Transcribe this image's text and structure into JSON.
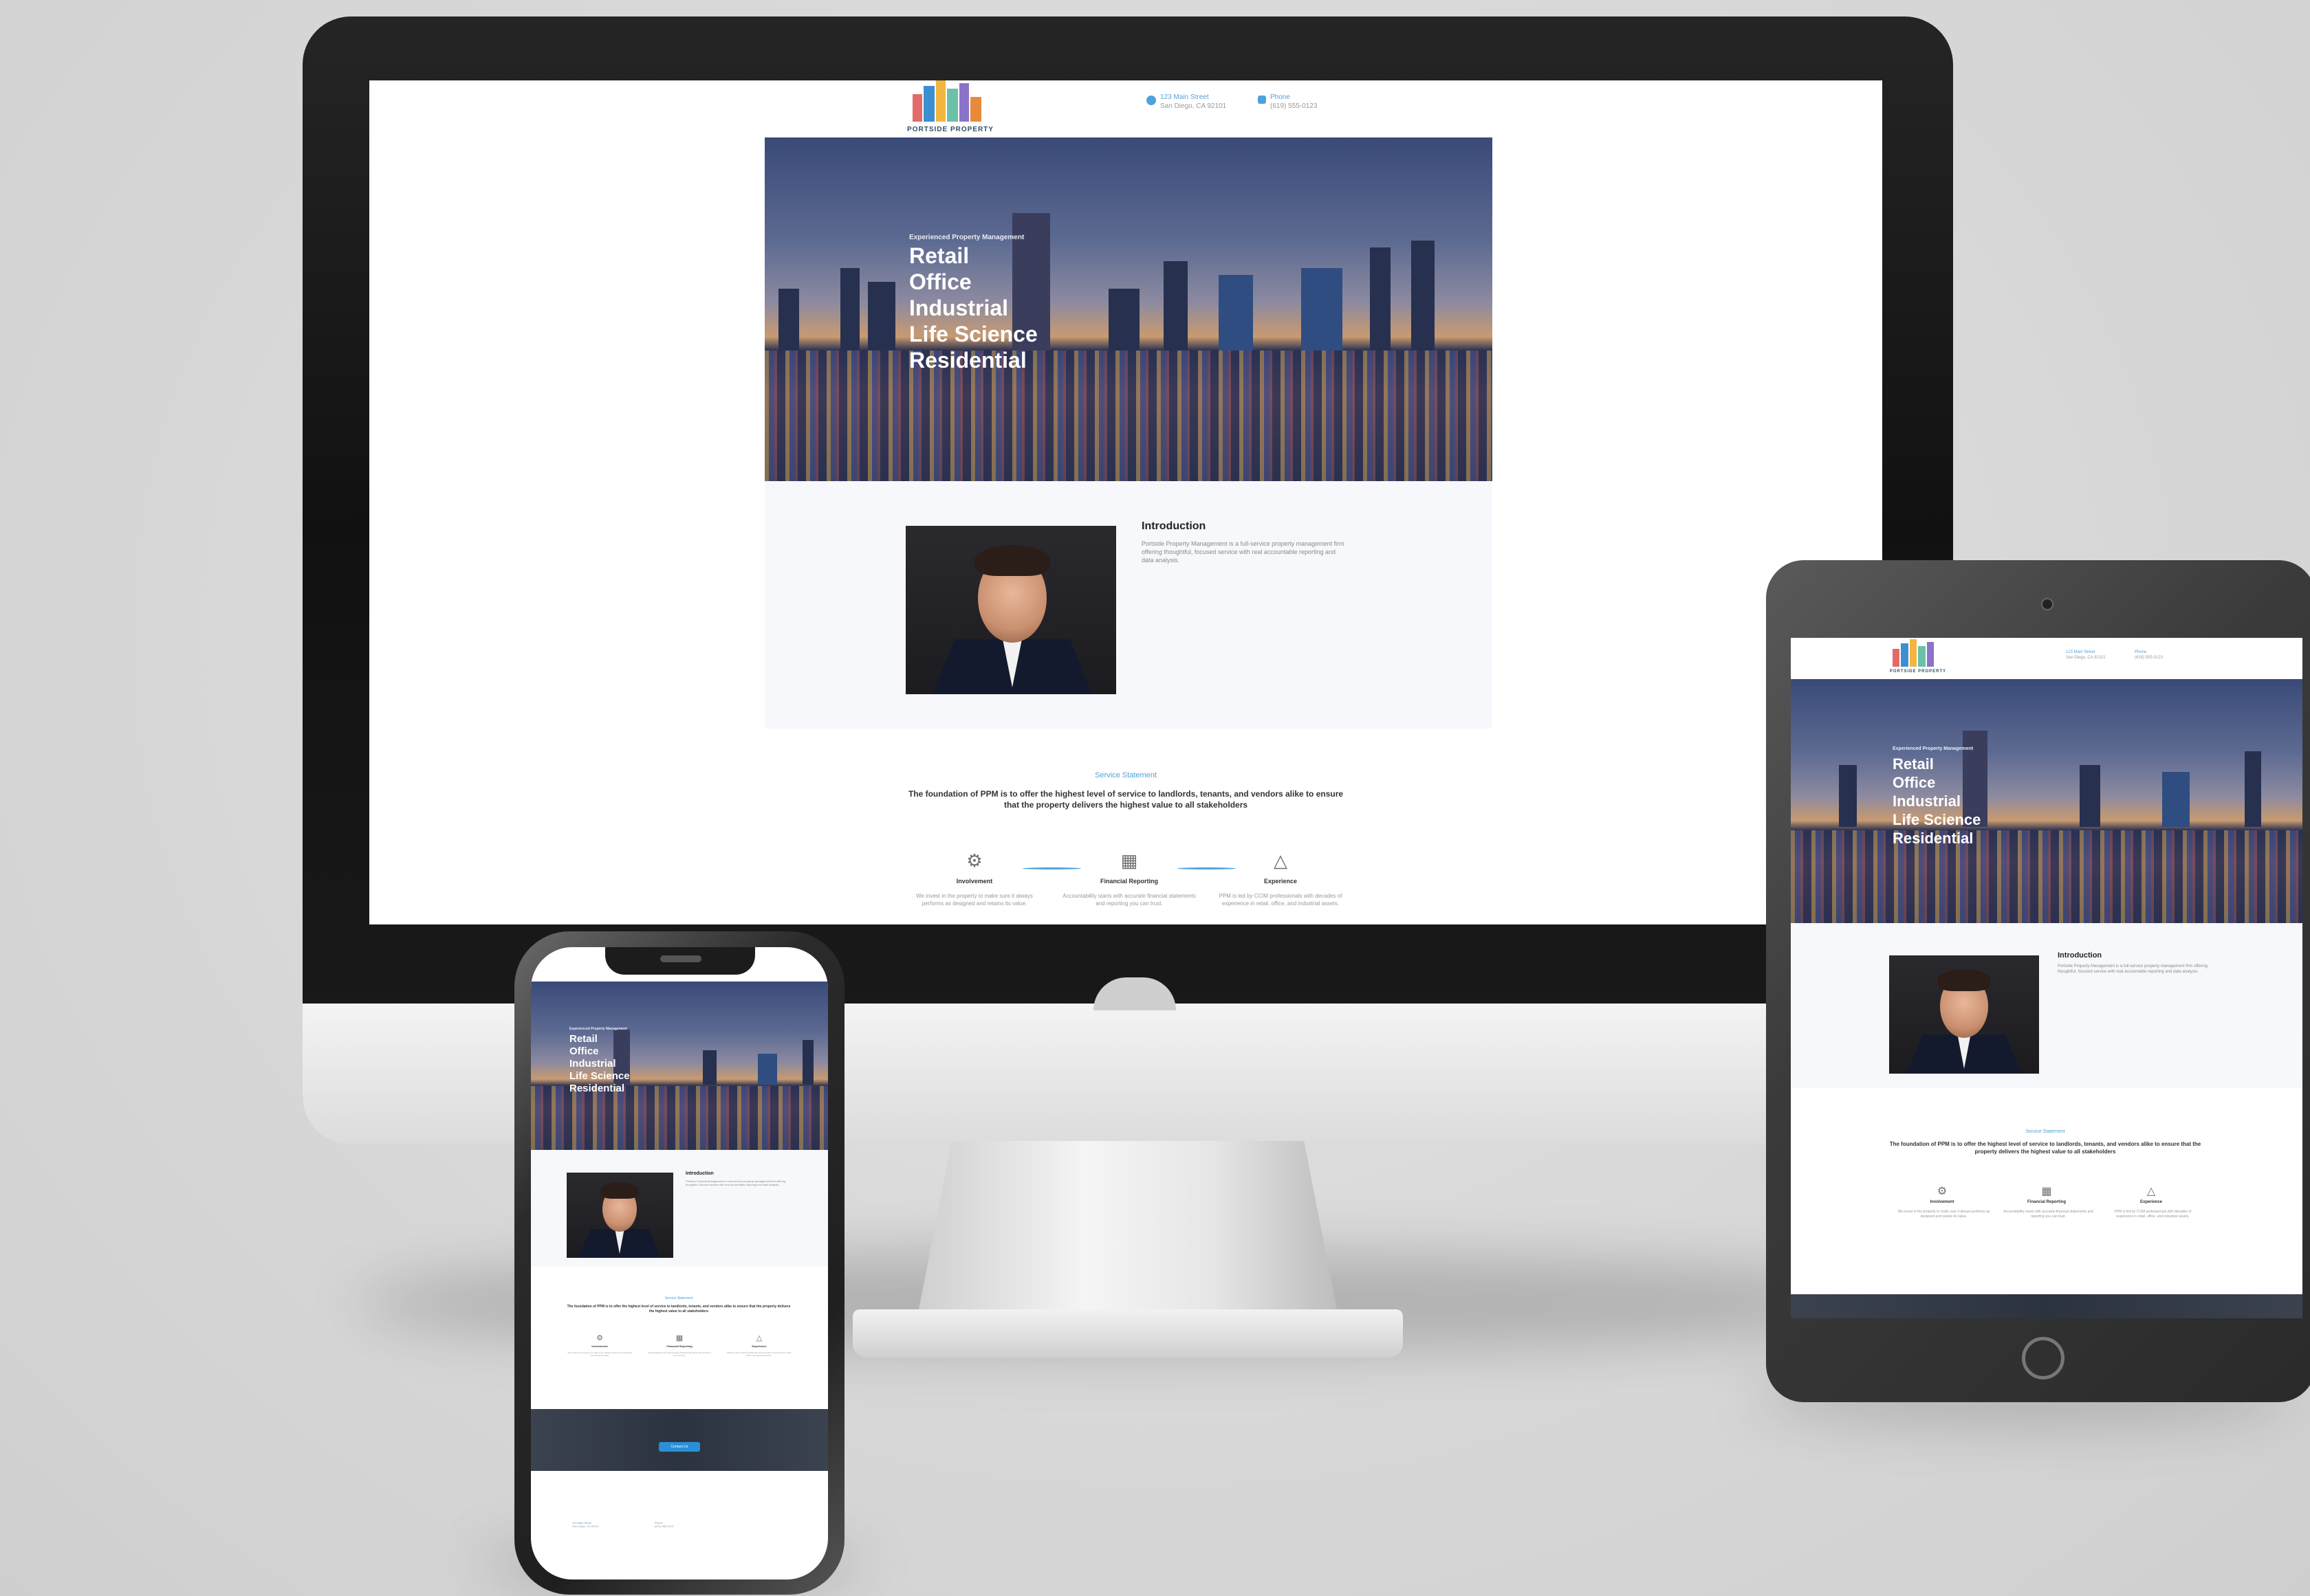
{
  "brand": {
    "name": "PORTSIDE PROPERTY"
  },
  "nav": {
    "address_line1": "123 Main Street",
    "address_line2": "San Diego, CA 92101",
    "phone_label": "Phone",
    "phone_value": "(619) 555-0123"
  },
  "hero": {
    "kicker": "Experienced Property Management",
    "lines": [
      "Retail",
      "Office",
      "Industrial",
      "Life Science",
      "Residential"
    ]
  },
  "intro": {
    "title": "Introduction",
    "text": "Portside Property Management is a full-service property management firm offering thoughtful, focused service with real accountable reporting and data analysis."
  },
  "mission": {
    "kicker": "Service Statement",
    "text": "The foundation of PPM is to offer the highest level of service to landlords, tenants, and vendors alike to ensure that the property delivers the highest value to all stakeholders"
  },
  "features": [
    {
      "icon": "gear-icon",
      "label": "Involvement",
      "text": "We invest in the property to make sure it always performs as designed and retains its value."
    },
    {
      "icon": "report-icon",
      "label": "Financial Reporting",
      "text": "Accountability starts with accurate financial statements and reporting you can trust."
    },
    {
      "icon": "triangle-icon",
      "label": "Experience",
      "text": "PPM is led by CCIM professionals with decades of experience in retail, office, and industrial assets."
    }
  ],
  "cta": {
    "button": "Contact Us"
  },
  "colors": {
    "accent": "#4da3dc",
    "button": "#2b8fd6",
    "footer_band": "#2c3340"
  }
}
